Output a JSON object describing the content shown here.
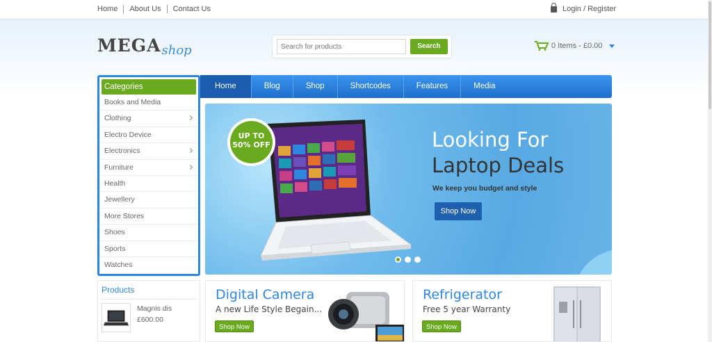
{
  "topbar": {
    "links": [
      "Home",
      "About Us",
      "Contact Us"
    ],
    "login_label": "Login / Register"
  },
  "header": {
    "logo_main": "MEGA",
    "logo_accent": "shop",
    "search_placeholder": "Search for products",
    "search_button": "Search",
    "cart_label": "0 Items - £0.00"
  },
  "categories": {
    "title": "Categories",
    "items": [
      {
        "label": "Books and Media",
        "has_sub": false
      },
      {
        "label": "Clothing",
        "has_sub": true
      },
      {
        "label": "Electro Device",
        "has_sub": false
      },
      {
        "label": "Electronics",
        "has_sub": true
      },
      {
        "label": "Furniture",
        "has_sub": true
      },
      {
        "label": "Health",
        "has_sub": false
      },
      {
        "label": "Jewellery",
        "has_sub": false
      },
      {
        "label": "More Stores",
        "has_sub": false
      },
      {
        "label": "Shoes",
        "has_sub": false
      },
      {
        "label": "Sports",
        "has_sub": false
      },
      {
        "label": "Watches",
        "has_sub": false
      }
    ]
  },
  "nav": {
    "items": [
      "Home",
      "Blog",
      "Shop",
      "Shortcodes",
      "Features",
      "Media"
    ],
    "active_index": 0
  },
  "hero": {
    "badge_line1": "UP TO",
    "badge_line2": "50% OFF",
    "headline_1": "Looking For",
    "headline_2": "Laptop Deals",
    "subtitle": "We keep you budget and style",
    "button": "Shop Now",
    "slides": 3,
    "active_slide": 0
  },
  "products": {
    "title": "Products",
    "items": [
      {
        "name": "Magnis dis",
        "price": "£600.00"
      }
    ]
  },
  "promos": [
    {
      "title": "Digital Camera",
      "subtitle": "A new Life Style Begain...",
      "button": "Shop Now"
    },
    {
      "title": "Refrigerator",
      "subtitle": "Free 5 year Warranty",
      "button": "Shop Now"
    }
  ],
  "colors": {
    "brand_blue": "#2f86df",
    "brand_green": "#6aaa1e",
    "nav_active": "#1a5cae"
  }
}
